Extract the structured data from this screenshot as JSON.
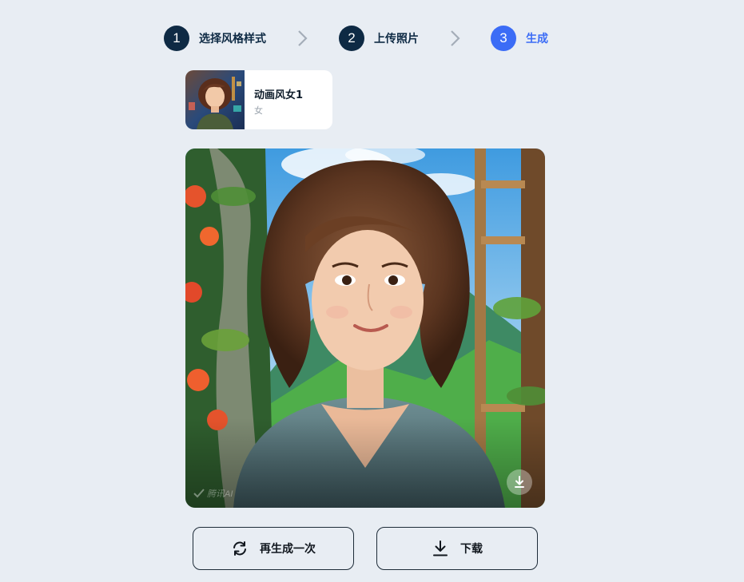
{
  "steps": [
    {
      "number": "1",
      "label": "选择风格样式",
      "state": "done"
    },
    {
      "number": "2",
      "label": "上传照片",
      "state": "done"
    },
    {
      "number": "3",
      "label": "生成",
      "state": "active"
    }
  ],
  "style_card": {
    "name": "动画风女1",
    "gender": "女"
  },
  "result_image": {
    "watermark": "腾讯AI",
    "download_icon": "download-icon"
  },
  "actions": {
    "regenerate_label": "再生成一次",
    "regenerate_icon": "refresh-icon",
    "download_label": "下载",
    "download_icon": "download-icon"
  },
  "colors": {
    "accent": "#3b6cf6",
    "dark_step": "#0e2a44",
    "background": "#e8edf3"
  }
}
